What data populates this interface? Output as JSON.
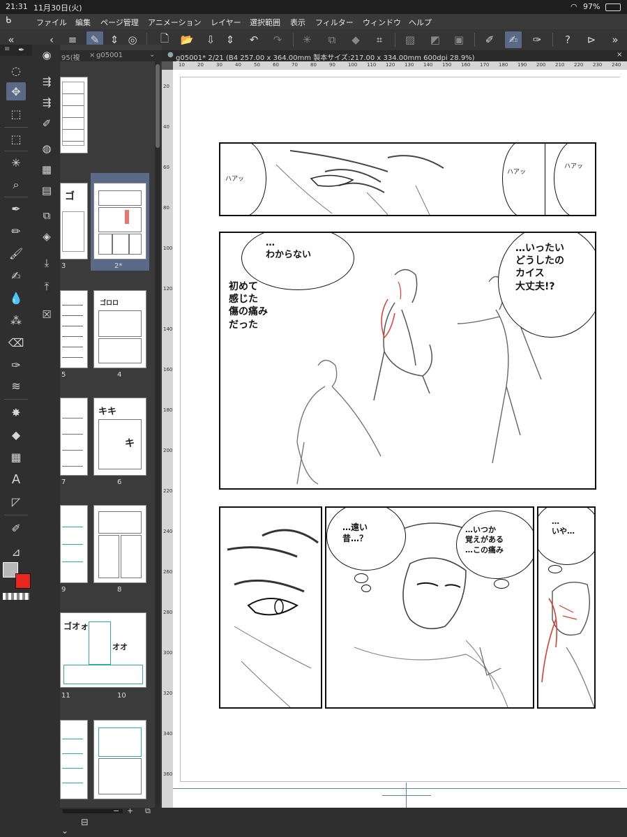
{
  "status": {
    "time": "21:31",
    "date": "11月30日(火)",
    "battery": "97%"
  },
  "menu": [
    "ファイル",
    "編集",
    "ページ管理",
    "アニメーション",
    "レイヤー",
    "選択範囲",
    "表示",
    "フィルター",
    "ウィンドウ",
    "ヘルプ"
  ],
  "page_panel": {
    "tab_left": "95(複",
    "tab_doc": "g05001",
    "pages": [
      {
        "label": ""
      },
      {
        "label": "3"
      },
      {
        "label": "2*"
      },
      {
        "label": "5"
      },
      {
        "label": "4"
      },
      {
        "label": "7"
      },
      {
        "label": "6"
      },
      {
        "label": "9"
      },
      {
        "label": "8"
      },
      {
        "label": "11"
      },
      {
        "label": "10"
      }
    ]
  },
  "document": {
    "tab_title": "g05001* 2/21 (B4 257.00 x 364.00mm 製本サイズ:217.00 x 334.00mm 600dpi 28.9%)"
  },
  "ruler": {
    "top": [
      "10",
      "20",
      "30",
      "40",
      "50",
      "60",
      "70",
      "80",
      "90",
      "100",
      "110",
      "120",
      "130",
      "140",
      "150",
      "160",
      "170",
      "180",
      "190",
      "200",
      "210",
      "220",
      "230",
      "240"
    ],
    "left": [
      "20",
      "40",
      "60",
      "80",
      "100",
      "120",
      "140",
      "160",
      "180",
      "200",
      "220",
      "240",
      "260",
      "280",
      "300",
      "320",
      "340",
      "360"
    ]
  },
  "manga": {
    "p1_sfx_a": "ハアッ",
    "p1_sfx_b": "ハアッ",
    "p1_sfx_c": "ハアッ",
    "p2_bubble_a": "…\nわからない",
    "p2_narration": "初めて\n感じた\n傷の痛み\nだった",
    "p2_bubble_b": "…いったい\nどうしたの\nカイス\n大丈夫!?",
    "p3_bubble": "…遠い\n昔…？",
    "p4_bubble": "…いつか\n覚えがある\n…この痛み",
    "p5_bubble": "…\nいや…"
  },
  "colors": {
    "accent": "#5a6a86",
    "main_color": "#b8b8b8",
    "sub_color": "#e8261e",
    "red_line": "#e23a2e"
  }
}
